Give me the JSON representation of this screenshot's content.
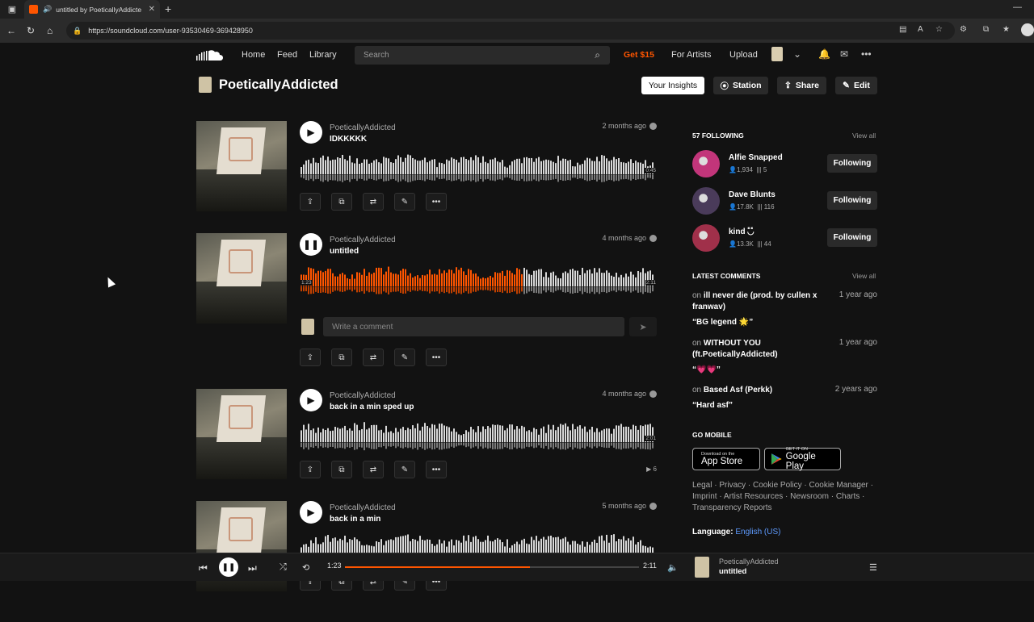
{
  "browser": {
    "tab_title": "untitled by PoeticallyAddicte",
    "url": "https://soundcloud.com/user-93530469-369428950"
  },
  "header": {
    "nav": [
      "Home",
      "Feed",
      "Library"
    ],
    "search_placeholder": "Search",
    "get15": "Get $15",
    "for_artists": "For Artists",
    "upload": "Upload"
  },
  "profile": {
    "name": "PoeticallyAddicted",
    "buttons": {
      "insights": "Your Insights",
      "station": "Station",
      "share": "Share",
      "edit": "Edit"
    }
  },
  "tracks": [
    {
      "artist": "PoeticallyAddicted",
      "title": "IDKKKKK",
      "age": "2 months ago",
      "duration": "0:45",
      "progress": 0,
      "playing": false,
      "plays": ""
    },
    {
      "artist": "PoeticallyAddicted",
      "title": "untitled",
      "age": "4 months ago",
      "duration": "2:11",
      "elapsed": "1:23",
      "progress": 0.63,
      "playing": true,
      "plays": ""
    },
    {
      "artist": "PoeticallyAddicted",
      "title": "back in a min sped up",
      "age": "4 months ago",
      "duration": "2:01",
      "progress": 0,
      "playing": false,
      "plays": "6"
    },
    {
      "artist": "PoeticallyAddicted",
      "title": "back in a min",
      "age": "5 months ago",
      "duration": "",
      "progress": 0,
      "playing": false,
      "plays": ""
    }
  ],
  "comment_placeholder": "Write a comment",
  "following": {
    "header": "57 FOLLOWING",
    "view_all": "View all",
    "users": [
      {
        "name": "Alfie Snapped",
        "followers": "1,934",
        "tracks": "5",
        "button": "Following",
        "color": "#c2357a"
      },
      {
        "name": "Dave Blunts",
        "followers": "17.8K",
        "tracks": "116",
        "button": "Following",
        "color": "#4a3b5a"
      },
      {
        "name": "kind ◟̽◞̽",
        "followers": "13.3K",
        "tracks": "44",
        "button": "Following",
        "color": "#a0304a"
      }
    ]
  },
  "comments": {
    "header": "LATEST COMMENTS",
    "view_all": "View all",
    "items": [
      {
        "on": "on",
        "track": "ill never die (prod. by cullen x franwav)",
        "when": "1 year ago",
        "text": "“BG legend 🌟”"
      },
      {
        "on": "on",
        "track": "WITHOUT YOU (ft.PoeticallyAddicted)",
        "when": "1 year ago",
        "text": "“💗💗”"
      },
      {
        "on": "on",
        "track": "Based Asf (Perkk)",
        "when": "2 years ago",
        "text": "“Hard asf”"
      }
    ]
  },
  "mobile": {
    "header": "GO MOBILE",
    "appstore_small": "Download on the",
    "appstore_large": "App Store",
    "gplay_small": "GET IT ON",
    "gplay_large": "Google Play"
  },
  "legal": "Legal · Privacy · Cookie Policy · Cookie Manager · Imprint · Artist Resources · Newsroom · Charts · Transparency Reports",
  "language": {
    "label": "Language:",
    "value": "English (US)"
  },
  "player": {
    "elapsed": "1:23",
    "duration": "2:11",
    "progress": 0.63,
    "artist": "PoeticallyAddicted",
    "title": "untitled"
  },
  "colors": {
    "accent": "#ff5500",
    "bg": "#121212"
  }
}
